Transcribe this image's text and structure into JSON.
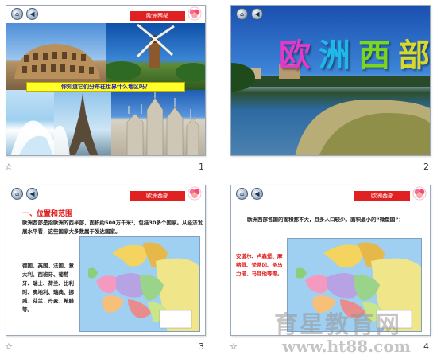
{
  "slides": [
    {
      "number": "1",
      "label": "欧洲西部",
      "banner": "你知道它们分布在世界什么地区吗？"
    },
    {
      "number": "2",
      "title_chars": [
        "欧",
        "洲",
        "西",
        "部"
      ]
    },
    {
      "number": "3",
      "label": "欧洲西部",
      "heading": "一、位置和范围",
      "intro": "欧洲西部是指欧洲的西半部，面积约500万千米²，包括30多个国家。从经济发展水平看，这些国家大多数属于发达国家。",
      "countries": "德国、英国、法国、意大利、西班牙、葡萄牙、瑞士、荷兰、比利时、奥地利、瑞典、挪威、芬兰、丹麦、希腊等。"
    },
    {
      "number": "4",
      "label": "欧洲西部",
      "intro": "欧洲西部各国的面积都不大，且多人口较少。面积最小的“微型国”：",
      "microstates": "安道尔、卢森堡、摩纳哥、梵蒂冈、圣马力诺、马耳他等等。"
    }
  ],
  "colors": {
    "accent_red": "#e01a1a",
    "banner_yellow": "#ffff2a",
    "banner_text": "#1c1cc2"
  },
  "icons": {
    "home": "house-icon",
    "back": "arrow-left-icon",
    "flower": "flower-icon",
    "star": "star-icon"
  },
  "watermark": {
    "cn": "育星教育网",
    "url": "www.ht88.com"
  }
}
